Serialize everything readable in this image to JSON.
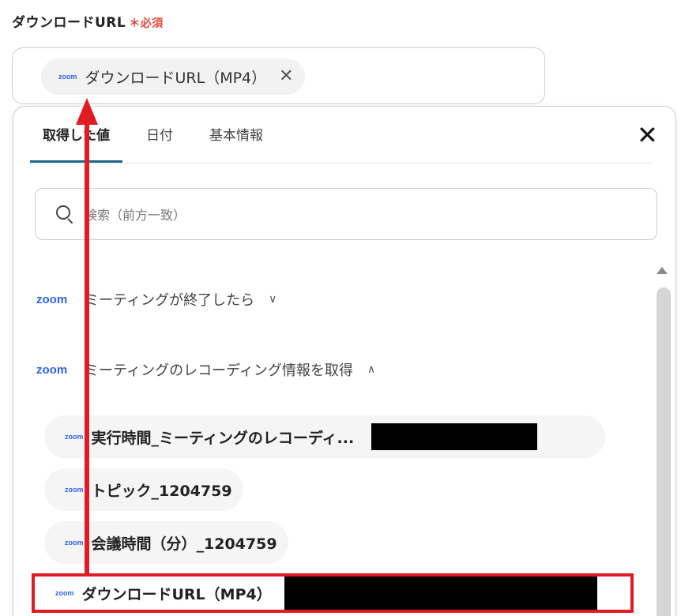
{
  "field": {
    "label": "ダウンロードURL",
    "required": "＊必須"
  },
  "chip": {
    "icon": "zoom",
    "label": "ダウンロードURL（MP4）",
    "close": "✕"
  },
  "tabs": [
    {
      "label": "取得した値",
      "active": true
    },
    {
      "label": "日付",
      "active": false
    },
    {
      "label": "基本情報",
      "active": false
    }
  ],
  "close_button": "✕",
  "search": {
    "placeholder": "検索（前方一致）"
  },
  "sections": [
    {
      "logo": "zoom",
      "label": "ミーティングが終了したら",
      "chevron": "∨"
    },
    {
      "logo": "zoom",
      "label": "ミーティングのレコーディング情報を取得",
      "chevron": "∧"
    }
  ],
  "items": [
    {
      "icon": "zoom",
      "label": "実行時間_ミーティングのレコーディ..."
    },
    {
      "icon": "zoom",
      "label": "トピック_1204759"
    },
    {
      "icon": "zoom",
      "label": "会議時間（分）_1204759"
    },
    {
      "icon": "zoom",
      "label": "ダウンロードURL（MP4）"
    }
  ],
  "colors": {
    "accent_tab": "#1b6a86",
    "zoom_blue": "#2d63ec",
    "required_red": "#e8453c",
    "annotation_red": "#e01b24"
  }
}
